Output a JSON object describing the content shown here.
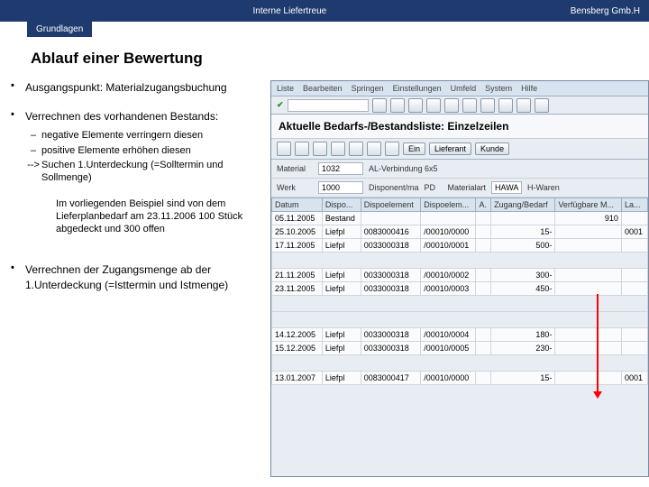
{
  "header": {
    "title": "Interne Liefertreue",
    "company": "Bensberg Gmb.H"
  },
  "tab": "Grundlagen",
  "heading": "Ablauf einer Bewertung",
  "bullets": [
    {
      "text": "Ausgangspunkt: Materialzugangsbuchung"
    },
    {
      "text": "Verrechnen des vorhandenen Bestands:",
      "sub": [
        {
          "mark": "–",
          "text": "negative Elemente verringern diesen"
        },
        {
          "mark": "–",
          "text": "positive Elemente erhöhen diesen"
        },
        {
          "mark": "-->",
          "text": "Suchen 1.Unterdeckung (=Solltermin und Sollmenge)"
        }
      ],
      "explain": "Im vorliegenden Beispiel sind von dem Lieferplanbedarf am 23.11.2006 100 Stück abgedeckt und 300 offen"
    },
    {
      "text": "Verrechnen der Zugangsmenge ab der 1.Unterdeckung (=Isttermin und Istmenge)"
    }
  ],
  "sap": {
    "menu": [
      "Liste",
      "Bearbeiten",
      "Springen",
      "Einstellungen",
      "Umfeld",
      "System",
      "Hilfe"
    ],
    "window_title": "Aktuelle Bedarfs-/Bestandsliste: Einzelzeilen",
    "toolbar2_buttons": [
      "Ein",
      "Lieferant",
      "Kunde"
    ],
    "fields": {
      "material_label": "Material",
      "material_value": "1032",
      "material_desc": "AL-Verbindung 6x5",
      "werk_label": "Werk",
      "werk_value": "1000",
      "werk_desc": "Disponent/ma",
      "disp_label": "PD",
      "disp_value": "Materialart",
      "mat_label": "HAWA",
      "mat_desc": "H-Waren"
    },
    "grid_headers": [
      "Datum",
      "Dispo...",
      "Dispoelement",
      "Dispoelem...",
      "A.",
      "Zugang/Bedarf",
      "Verfügbare M...",
      "La..."
    ],
    "rows": [
      {
        "d": "05.11.2005",
        "e": "Bestand",
        "el": "",
        "de": "",
        "a": "",
        "zb": "",
        "vm": "910",
        "la": ""
      },
      {
        "d": "25.10.2005",
        "e": "Liefpl",
        "el": "0083000416",
        "de": "/00010/0000",
        "a": "",
        "zb": "15-",
        "vm": "",
        "la": "0001"
      },
      {
        "d": "17.11.2005",
        "e": "Liefpl",
        "el": "0033000318",
        "de": "/00010/0001",
        "a": "",
        "zb": "500-",
        "vm": "",
        "la": ""
      },
      "gap",
      {
        "d": "21.11.2005",
        "e": "Liefpl",
        "el": "0033000318",
        "de": "/00010/0002",
        "a": "",
        "zb": "300-",
        "vm": "",
        "la": ""
      },
      {
        "d": "23.11.2005",
        "e": "Liefpl",
        "el": "0033000318",
        "de": "/00010/0003",
        "a": "",
        "zb": "450-",
        "vm": "",
        "la": ""
      },
      "gap",
      "gap",
      {
        "d": "14.12.2005",
        "e": "Liefpl",
        "el": "0033000318",
        "de": "/00010/0004",
        "a": "",
        "zb": "180-",
        "vm": "",
        "la": ""
      },
      {
        "d": "15.12.2005",
        "e": "Liefpl",
        "el": "0033000318",
        "de": "/00010/0005",
        "a": "",
        "zb": "230-",
        "vm": "",
        "la": ""
      },
      "gap",
      {
        "d": "13.01.2007",
        "e": "Liefpl",
        "el": "0083000417",
        "de": "/00010/0000",
        "a": "",
        "zb": "15-",
        "vm": "",
        "la": "0001"
      }
    ]
  }
}
